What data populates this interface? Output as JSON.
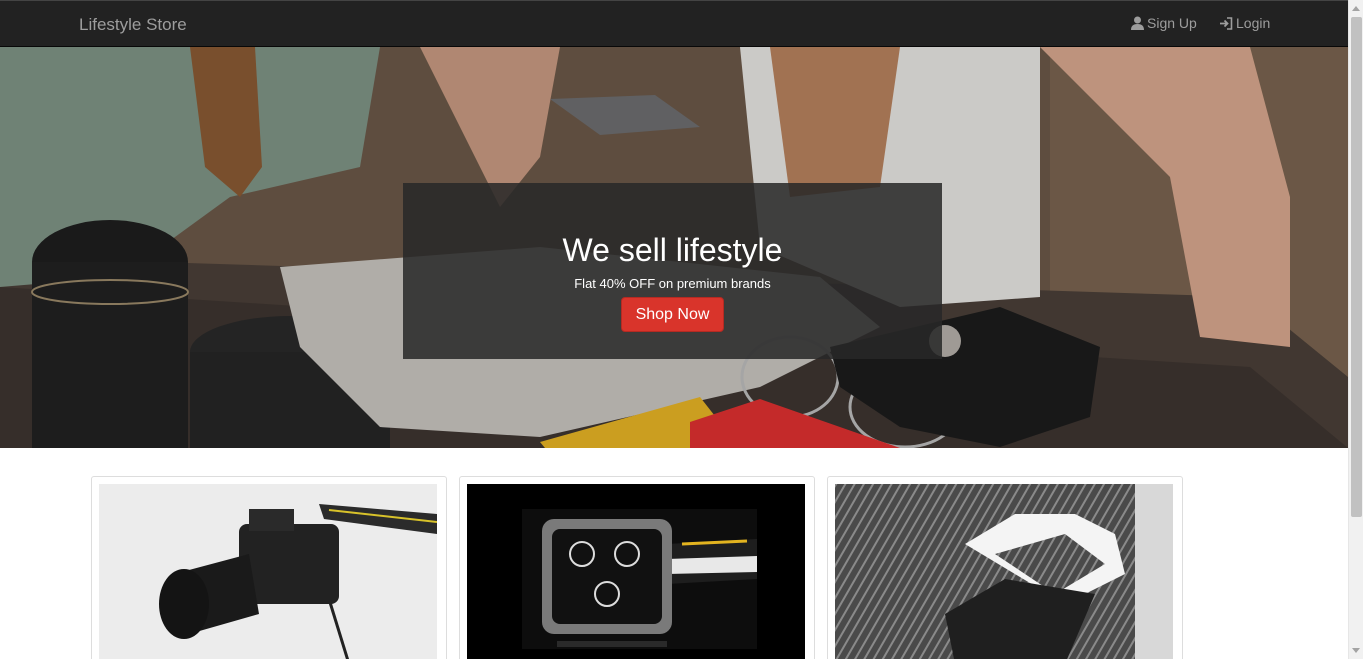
{
  "navbar": {
    "brand": "Lifestyle Store",
    "signup_label": "Sign Up",
    "login_label": "Login",
    "signup_icon": "user-icon",
    "login_icon": "log-in-icon"
  },
  "hero": {
    "title": "We sell lifestyle",
    "subtitle": "Flat 40% OFF on premium brands",
    "cta_label": "Shop Now",
    "cta_color": "#d9342b"
  },
  "products": [
    {
      "image": "camera-photo"
    },
    {
      "image": "watch-photo"
    },
    {
      "image": "shirt-photo"
    }
  ],
  "colors": {
    "navbar_bg": "#222222",
    "nav_text": "#9d9d9d"
  }
}
